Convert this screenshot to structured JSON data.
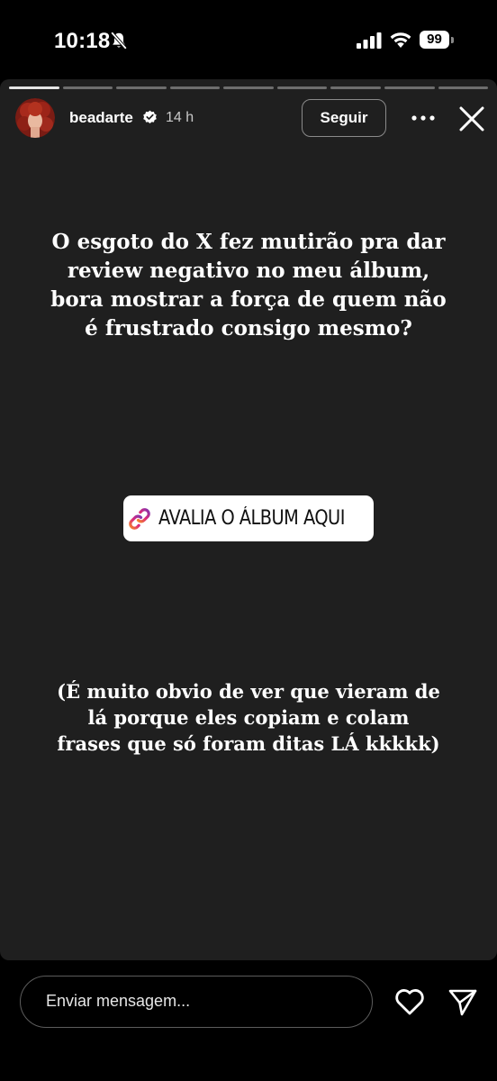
{
  "status_bar": {
    "time": "10:18",
    "battery": "99",
    "icons": [
      "bell-off-icon",
      "signal-icon",
      "wifi-icon",
      "battery-icon"
    ]
  },
  "story": {
    "progress_segments": 9,
    "progress_completed": 1,
    "username": "beadarte",
    "verified": true,
    "timestamp": "14 h",
    "follow_label": "Seguir",
    "main_text": "O esgoto do X fez mutirão pra dar\nreview negativo no meu álbum,\nbora mostrar a força de quem não\né frustrado consigo mesmo?",
    "link_sticker_label": "AVALIA O ÁLBUM AQUI",
    "note_text": "(É muito obvio de ver que vieram de\nlá porque eles copiam e colam\nfrases que só foram ditas LÁ kkkkk)"
  },
  "bottom_bar": {
    "message_placeholder": "Enviar mensagem..."
  },
  "colors": {
    "background": "#000000",
    "story_background": "#1f1f1f",
    "verified_badge": "#ffffff",
    "link_gradient_start": "#f58529",
    "link_gradient_end": "#8134af"
  }
}
